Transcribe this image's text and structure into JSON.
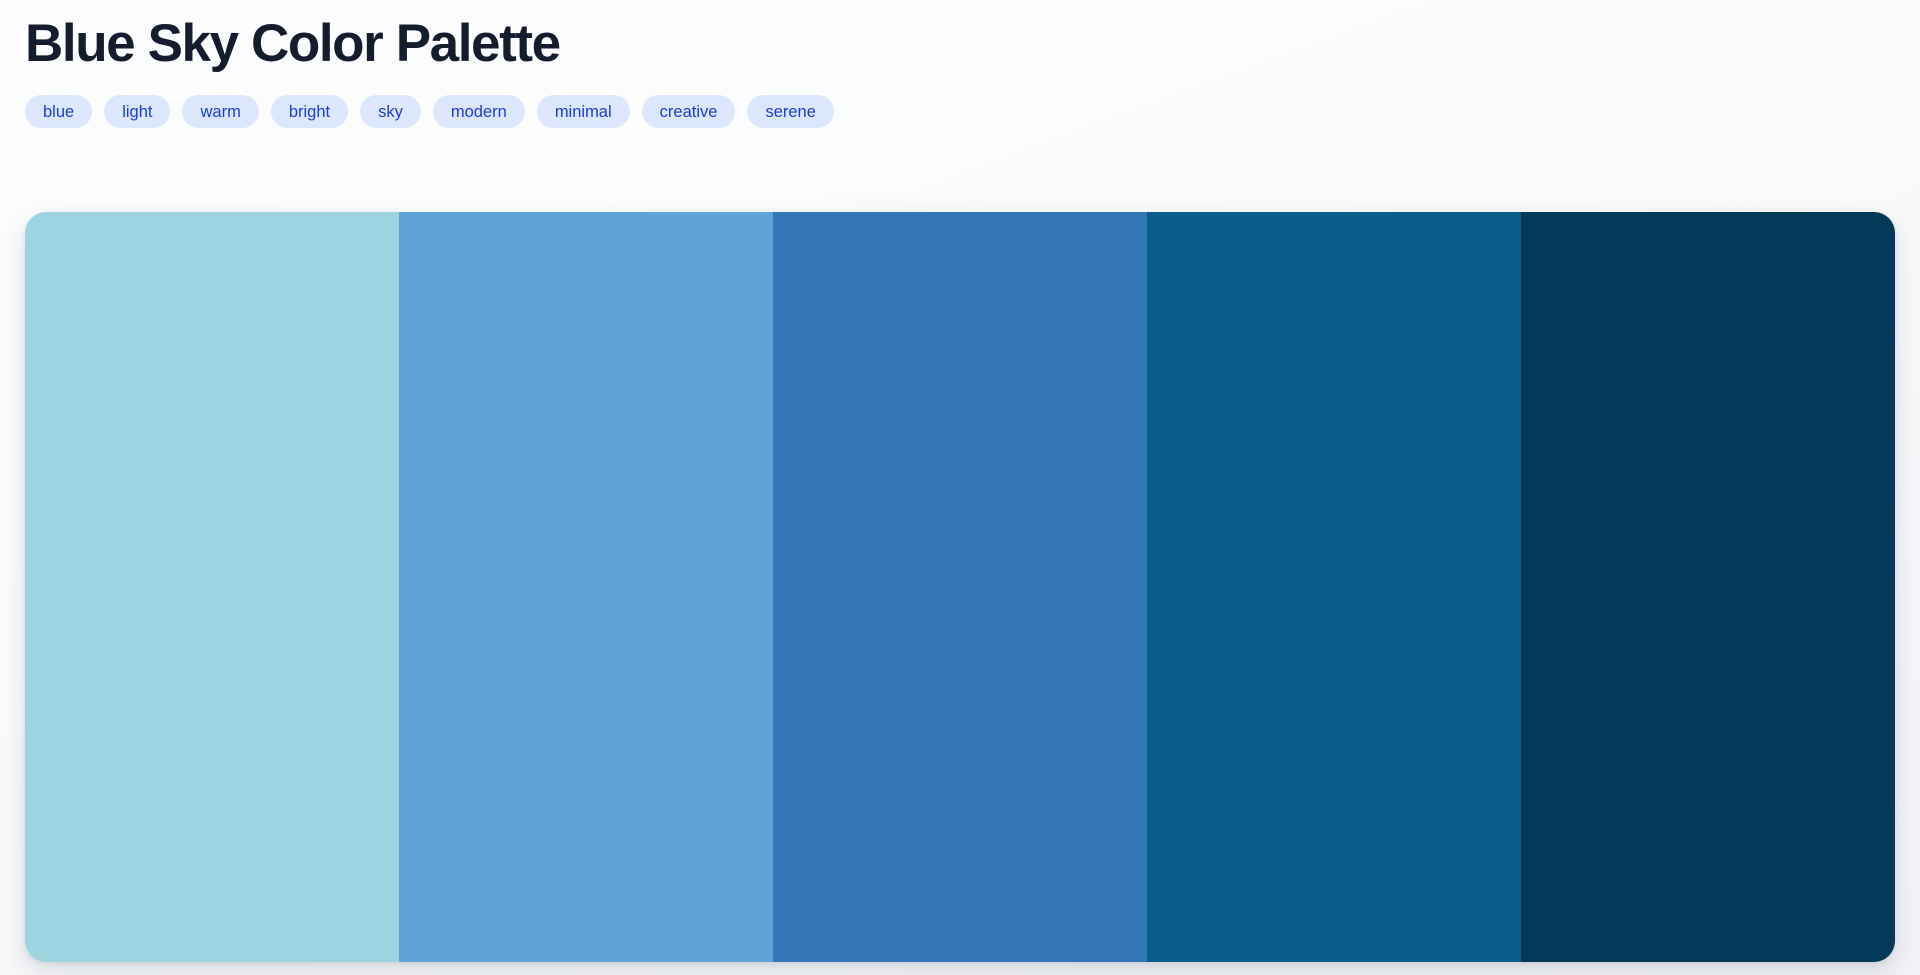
{
  "header": {
    "title": "Blue Sky Color Palette",
    "tags": [
      {
        "label": "blue"
      },
      {
        "label": "light"
      },
      {
        "label": "warm"
      },
      {
        "label": "bright"
      },
      {
        "label": "sky"
      },
      {
        "label": "modern"
      },
      {
        "label": "minimal"
      },
      {
        "label": "creative"
      },
      {
        "label": "serene"
      }
    ]
  },
  "palette": {
    "swatches": [
      {
        "name": "swatch-1",
        "hex": "#9ED4E0"
      },
      {
        "name": "swatch-2",
        "hex": "#5EA5D5"
      },
      {
        "name": "swatch-3",
        "hex": "#3278B6"
      },
      {
        "name": "swatch-4",
        "hex": "#0B5E8A"
      },
      {
        "name": "swatch-5",
        "hex": "#033A5A"
      }
    ]
  },
  "theme": {
    "page_background_start": "#fdfdfe",
    "page_background_end": "#f1f3f6",
    "title_color": "#141c2e",
    "tag_background": "#dce7fd",
    "tag_text_color": "#1b3ed6"
  }
}
